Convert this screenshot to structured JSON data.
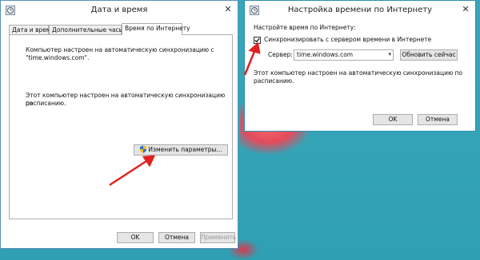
{
  "window1": {
    "title": "Дата и время",
    "tabs": [
      {
        "label": "Дата и время"
      },
      {
        "label": "Дополнительные часы"
      },
      {
        "label": "Время по Интернету"
      }
    ],
    "text1_line1": "Компьютер настроен на автоматическую синхронизацию с",
    "text1_line2": "\"time.windows.com\".",
    "text2_line1": "Этот компьютер настроен на автоматическую синхронизацию по",
    "text2_line2": "расписанию.",
    "change_settings_label": "Изменить параметры...",
    "ok_label": "OK",
    "cancel_label": "Отмена",
    "apply_label": "Применить"
  },
  "window2": {
    "title": "Настройка времени по Интернету",
    "heading": "Настройте время по Интернету:",
    "sync_checkbox_label": "Синхронизировать с сервером времени в Интернете",
    "sync_checked": true,
    "server_label": "Сервер:",
    "server_value": "time.windows.com",
    "update_now_label": "Обновить сейчас",
    "status_line1": "Этот компьютер настроен на автоматическую синхронизацию по",
    "status_line2": "расписанию.",
    "ok_label": "OK",
    "cancel_label": "Отмена"
  },
  "colors": {
    "desktop": "#34a3b6",
    "window_border": "#5a8fb8",
    "arrow": "#e02020"
  },
  "icons": {
    "title_icon": "clock-icon",
    "shield": "uac-shield-icon",
    "close": "close-icon"
  }
}
